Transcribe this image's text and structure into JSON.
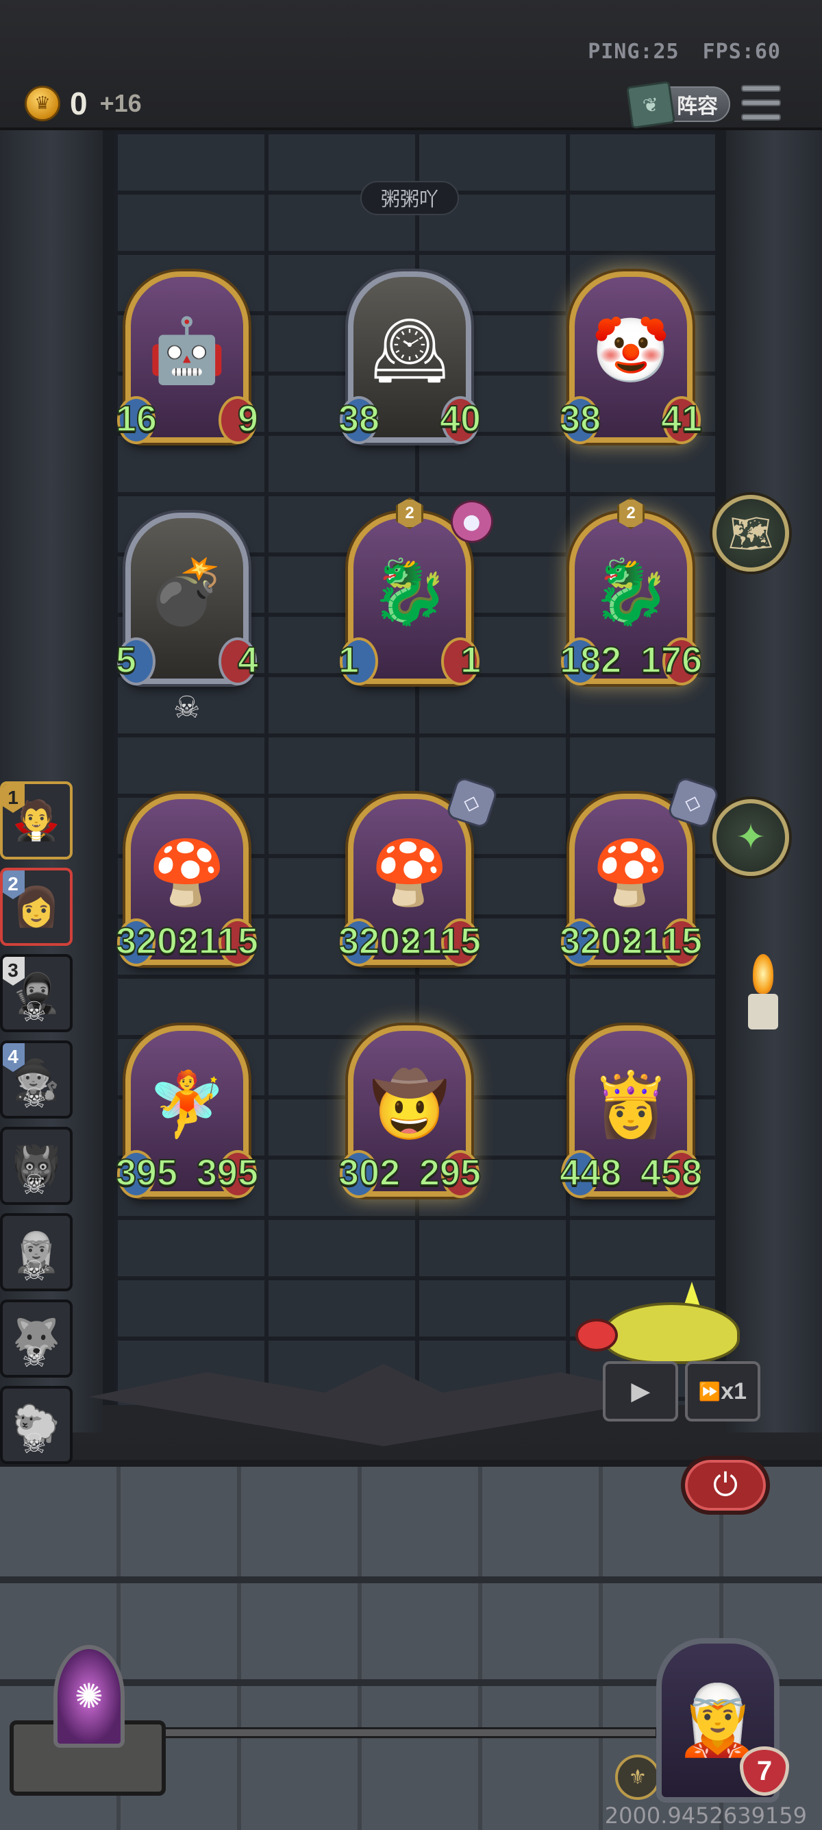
{
  "hud": {
    "ping_label": "PING:25",
    "fps_label": "FPS:60",
    "gold": "0",
    "gold_income": "+16",
    "lineup_label": "阵容"
  },
  "board": {
    "opponent_name": "粥粥吖",
    "units": [
      {
        "attack": "16",
        "health": "9",
        "frame": "gold",
        "art": "robot-duo"
      },
      {
        "attack": "38",
        "health": "40",
        "frame": "silver",
        "art": "clock-creature"
      },
      {
        "attack": "38",
        "health": "41",
        "frame": "gold",
        "art": "clown"
      },
      {
        "attack": "5",
        "health": "4",
        "frame": "silver",
        "art": "bomb-knight"
      },
      {
        "attack": "1",
        "health": "1",
        "frame": "gold",
        "art": "red-dragon",
        "star": "2"
      },
      {
        "attack": "182",
        "health": "176",
        "frame": "gold",
        "art": "red-dragon",
        "star": "2"
      },
      {
        "attack": "3209",
        "health": "2115",
        "frame": "gold",
        "art": "mushroom-girl"
      },
      {
        "attack": "3209",
        "health": "2115",
        "frame": "gold",
        "art": "mushroom-girl"
      },
      {
        "attack": "3209",
        "health": "2115",
        "frame": "gold",
        "art": "mushroom-girl"
      },
      {
        "attack": "395",
        "health": "395",
        "frame": "gold",
        "art": "flower-fairy"
      },
      {
        "attack": "302",
        "health": "295",
        "frame": "gold",
        "art": "gunslinger"
      },
      {
        "attack": "448",
        "health": "458",
        "frame": "gold",
        "art": "blonde-elf"
      }
    ]
  },
  "queue": [
    {
      "num": "1",
      "state": "active"
    },
    {
      "num": "2",
      "state": "selected"
    },
    {
      "num": "3",
      "state": "dead"
    },
    {
      "num": "4",
      "state": "dead"
    },
    {
      "num": "",
      "state": "dead"
    },
    {
      "num": "",
      "state": "dead"
    },
    {
      "num": "",
      "state": "dead"
    },
    {
      "num": "",
      "state": "dead"
    }
  ],
  "controls": {
    "speed_label": "x1"
  },
  "hero": {
    "level": "7"
  },
  "footer": {
    "id_text": "2000.9452639159"
  },
  "colors": {
    "stat_text": "#aef08a",
    "gold_frame": "#c79b3e",
    "silver_frame": "#8e94a4",
    "power_red": "#a3292b"
  }
}
